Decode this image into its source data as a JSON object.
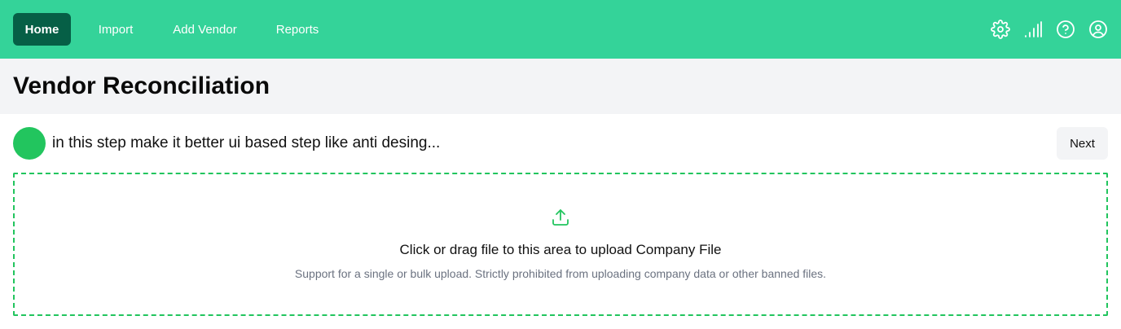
{
  "nav": {
    "items": [
      {
        "label": "Home",
        "active": true
      },
      {
        "label": "Import",
        "active": false
      },
      {
        "label": "Add Vendor",
        "active": false
      },
      {
        "label": "Reports",
        "active": false
      }
    ],
    "icons": [
      "settings-icon",
      "signal-icon",
      "help-icon",
      "user-icon"
    ]
  },
  "page": {
    "title": "Vendor Reconciliation"
  },
  "step": {
    "text": "in this step make it better ui based step like anti desing...",
    "next_label": "Next"
  },
  "upload": {
    "title": "Click or drag file to this area to upload Company File",
    "hint": "Support for a single or bulk upload. Strictly prohibited from uploading company data or other banned files.",
    "icon": "upload-icon"
  },
  "colors": {
    "topbar": "#34d399",
    "active_nav": "#065f46",
    "accent": "#22c55e",
    "title_band": "#f3f4f6"
  }
}
